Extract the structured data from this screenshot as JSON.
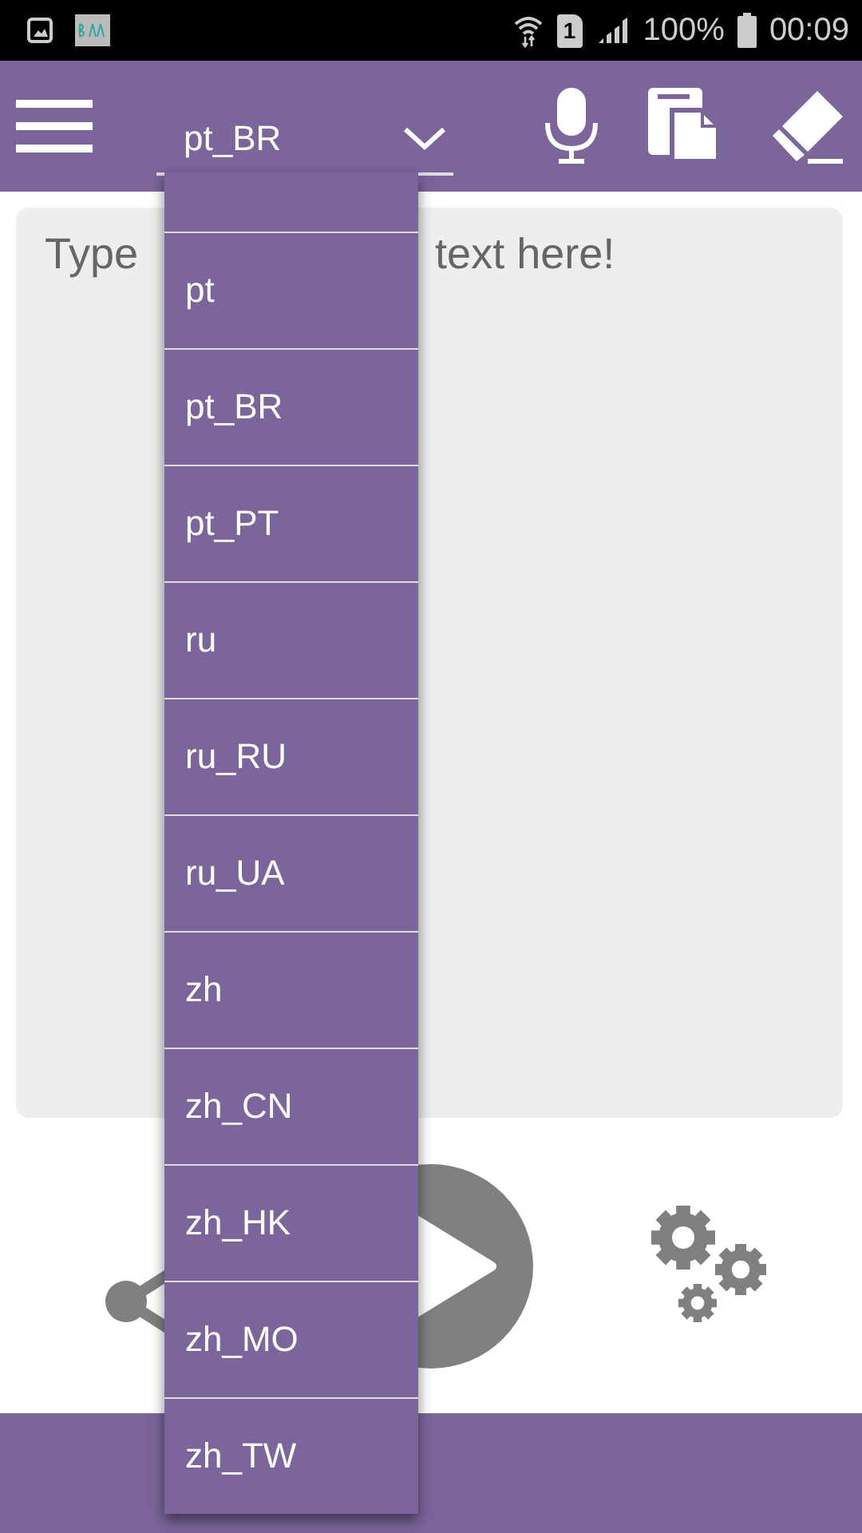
{
  "status_bar": {
    "sim_slot": "1",
    "battery": "100%",
    "time": "00:09"
  },
  "toolbar": {
    "language": "pt_BR"
  },
  "text_area": {
    "placeholder_parts": [
      "Type",
      "text here!"
    ]
  },
  "language_menu": {
    "items": [
      {
        "label": "pt"
      },
      {
        "label": "pt_BR"
      },
      {
        "label": "pt_PT"
      },
      {
        "label": "ru"
      },
      {
        "label": "ru_RU"
      },
      {
        "label": "ru_UA"
      },
      {
        "label": "zh"
      },
      {
        "label": "zh_CN"
      },
      {
        "label": "zh_HK"
      },
      {
        "label": "zh_MO"
      },
      {
        "label": "zh_TW"
      }
    ]
  }
}
